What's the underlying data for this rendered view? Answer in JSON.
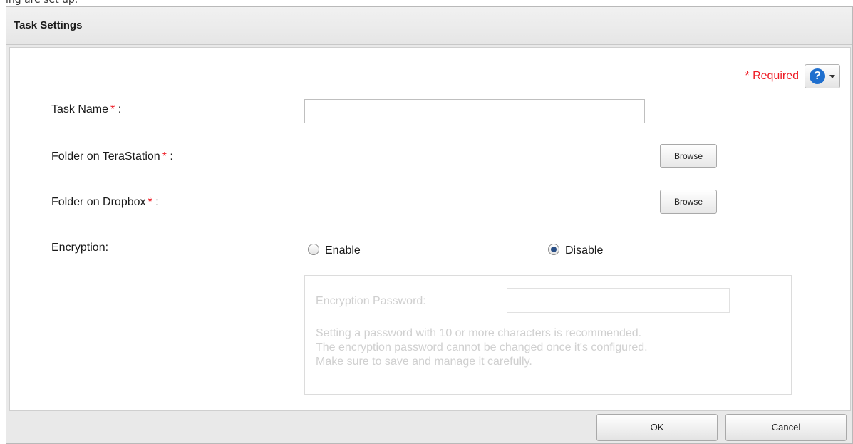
{
  "top_strip_text": "ing are set up.",
  "dialog": {
    "title": "Task Settings",
    "required_note": "*  Required",
    "help_icon": "question-circle-icon",
    "fields": {
      "task_name": {
        "label": "Task Name",
        "star": "*",
        "suffix": " :",
        "value": ""
      },
      "folder_terastation": {
        "label": "Folder on TeraStation",
        "star": "*",
        "suffix": " :",
        "browse": "Browse"
      },
      "folder_dropbox": {
        "label": "Folder on Dropbox",
        "star": "*",
        "suffix": " :",
        "browse": "Browse"
      },
      "encryption": {
        "label": "Encryption:",
        "options": [
          "Enable",
          "Disable"
        ],
        "selected": "Disable"
      }
    },
    "encryption_box": {
      "password_label": "Encryption Password:",
      "password_value": "",
      "note_lines": [
        "Setting a password with 10 or more characters is recommended.",
        "The encryption password cannot be changed once it's configured.",
        "Make sure to save and manage it carefully."
      ]
    },
    "buttons": {
      "ok": "OK",
      "cancel": "Cancel"
    }
  }
}
